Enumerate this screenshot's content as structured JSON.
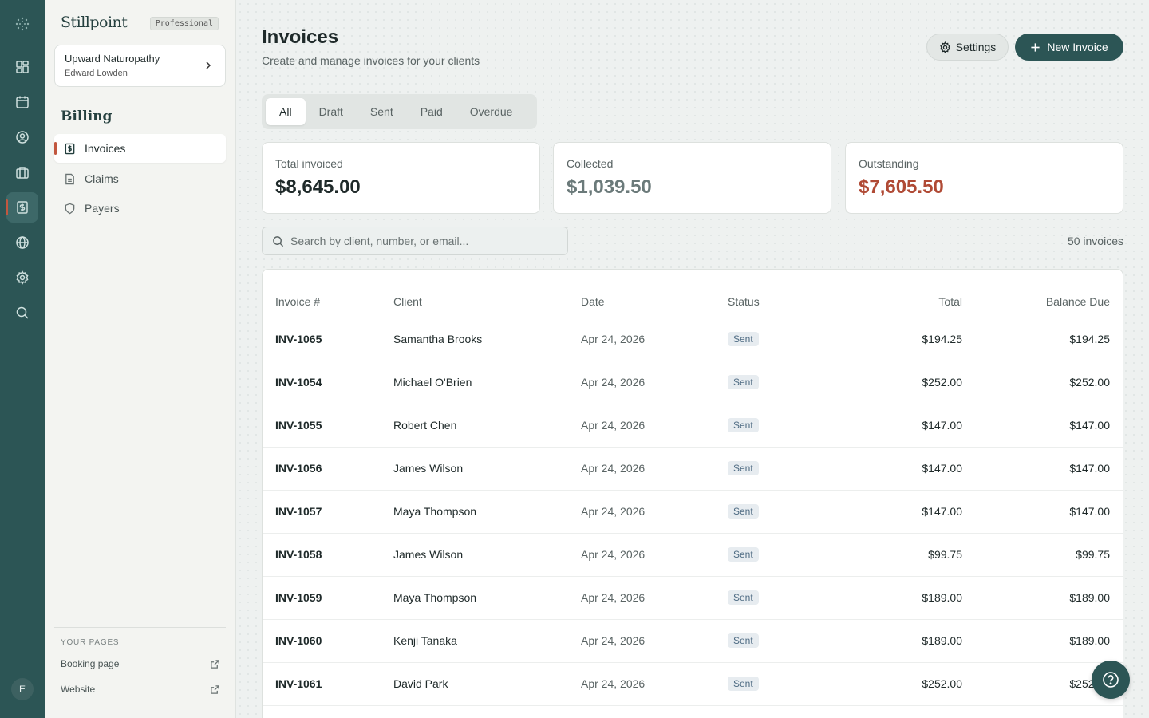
{
  "app": {
    "brand": "Stillpoint",
    "plan": "Professional"
  },
  "org": {
    "name": "Upward Naturopathy",
    "user": "Edward Lowden"
  },
  "sidebar": {
    "section_title": "Billing",
    "items": [
      {
        "label": "Invoices",
        "icon": "invoice-icon",
        "active": true
      },
      {
        "label": "Claims",
        "icon": "document-icon",
        "active": false
      },
      {
        "label": "Payers",
        "icon": "shield-icon",
        "active": false
      }
    ],
    "pages_label": "YOUR PAGES",
    "pages": [
      {
        "label": "Booking page",
        "icon": "external-link-icon"
      },
      {
        "label": "Website",
        "icon": "external-link-icon"
      }
    ]
  },
  "rail": {
    "avatar_initial": "E",
    "icons": [
      "dashboard-icon",
      "calendar-icon",
      "user-circle-icon",
      "briefcase-icon",
      "invoice-icon",
      "globe-icon",
      "gear-icon",
      "search-icon"
    ],
    "active_icon": "invoice-icon"
  },
  "header": {
    "title": "Invoices",
    "subtitle": "Create and manage invoices for your clients",
    "settings_label": "Settings",
    "new_label": "New Invoice"
  },
  "tabs": [
    "All",
    "Draft",
    "Sent",
    "Paid",
    "Overdue"
  ],
  "active_tab": "All",
  "stats": [
    {
      "label": "Total invoiced",
      "value": "$8,645.00",
      "color": "#1f2a2a"
    },
    {
      "label": "Collected",
      "value": "$1,039.50",
      "color": "#6b7a7a"
    },
    {
      "label": "Outstanding",
      "value": "$7,605.50",
      "color": "#b04a35"
    }
  ],
  "search": {
    "placeholder": "Search by client, number, or email..."
  },
  "count_label": "50 invoices",
  "table": {
    "columns": [
      "Invoice #",
      "Client",
      "Date",
      "Status",
      "Total",
      "Balance Due"
    ],
    "rows": [
      {
        "num": "INV-1065",
        "client": "Samantha Brooks",
        "date": "Apr 24, 2026",
        "status": "Sent",
        "total": "$194.25",
        "balance": "$194.25"
      },
      {
        "num": "INV-1054",
        "client": "Michael O'Brien",
        "date": "Apr 24, 2026",
        "status": "Sent",
        "total": "$252.00",
        "balance": "$252.00"
      },
      {
        "num": "INV-1055",
        "client": "Robert Chen",
        "date": "Apr 24, 2026",
        "status": "Sent",
        "total": "$147.00",
        "balance": "$147.00"
      },
      {
        "num": "INV-1056",
        "client": "James Wilson",
        "date": "Apr 24, 2026",
        "status": "Sent",
        "total": "$147.00",
        "balance": "$147.00"
      },
      {
        "num": "INV-1057",
        "client": "Maya Thompson",
        "date": "Apr 24, 2026",
        "status": "Sent",
        "total": "$147.00",
        "balance": "$147.00"
      },
      {
        "num": "INV-1058",
        "client": "James Wilson",
        "date": "Apr 24, 2026",
        "status": "Sent",
        "total": "$99.75",
        "balance": "$99.75"
      },
      {
        "num": "INV-1059",
        "client": "Maya Thompson",
        "date": "Apr 24, 2026",
        "status": "Sent",
        "total": "$189.00",
        "balance": "$189.00"
      },
      {
        "num": "INV-1060",
        "client": "Kenji Tanaka",
        "date": "Apr 24, 2026",
        "status": "Sent",
        "total": "$189.00",
        "balance": "$189.00"
      },
      {
        "num": "INV-1061",
        "client": "David Park",
        "date": "Apr 24, 2026",
        "status": "Sent",
        "total": "$252.00",
        "balance": "$252.00"
      },
      {
        "num": "",
        "client": "",
        "date": "",
        "status": "",
        "total": "",
        "balance": ""
      }
    ]
  },
  "colors": {
    "rail": "#2c5555",
    "accent": "#c2573f",
    "primary_button": "#2c5555"
  }
}
